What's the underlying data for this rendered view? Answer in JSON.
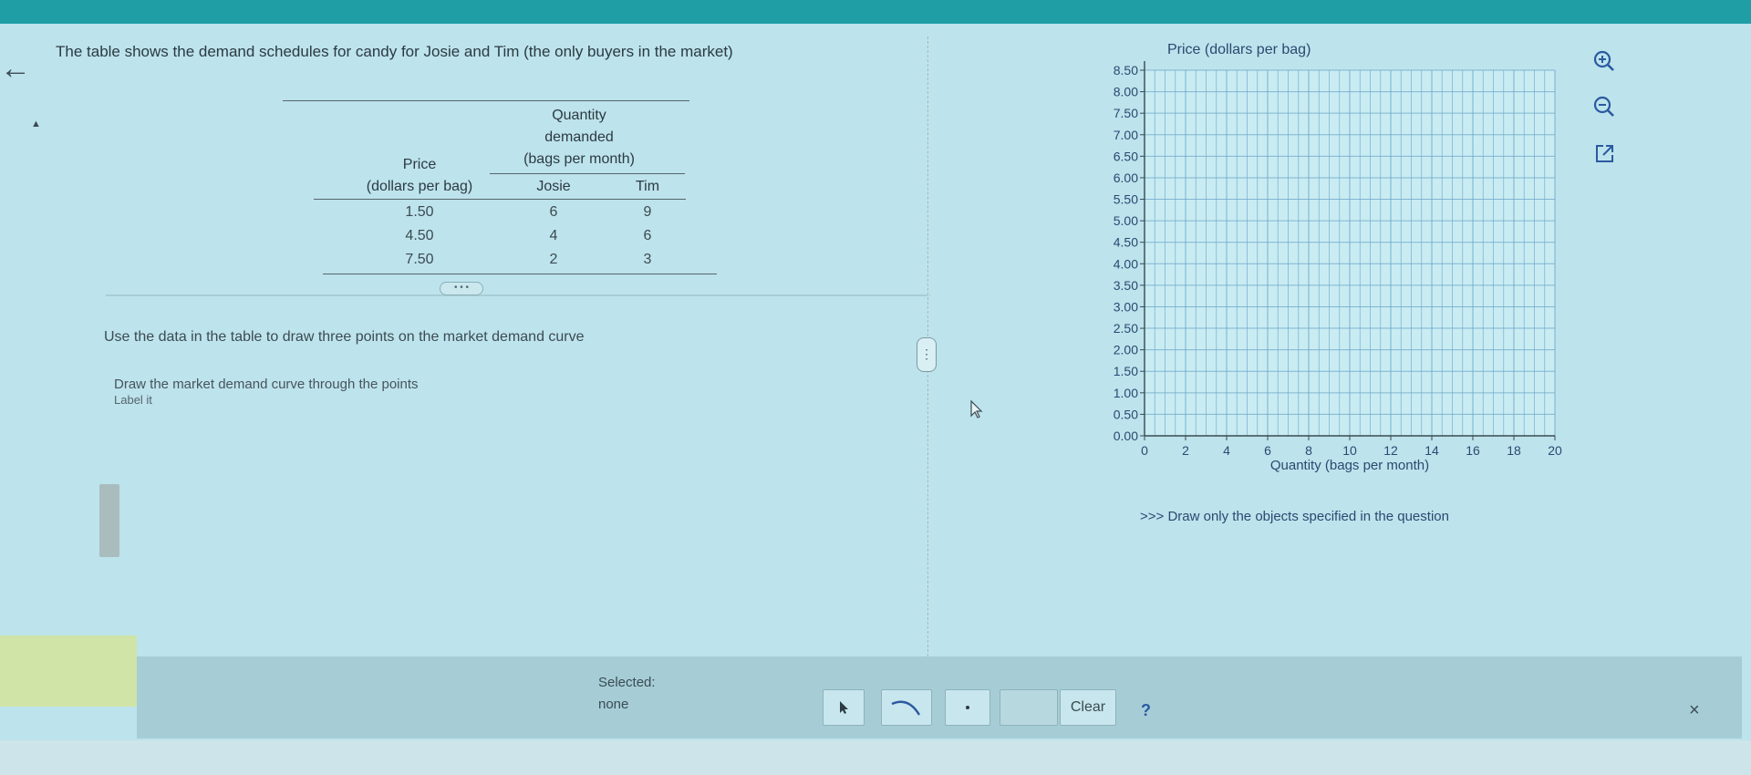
{
  "prompt": "The table shows the demand schedules for candy for Josie and Tim (the only buyers in the market)",
  "table": {
    "header_group": [
      "Quantity",
      "demanded",
      "(bags per month)"
    ],
    "price_header": [
      "Price",
      "(dollars per bag)"
    ],
    "columns": [
      "Josie",
      "Tim"
    ],
    "rows": [
      {
        "price": "1.50",
        "josie": "6",
        "tim": "9"
      },
      {
        "price": "4.50",
        "josie": "4",
        "tim": "6"
      },
      {
        "price": "7.50",
        "josie": "2",
        "tim": "3"
      }
    ]
  },
  "more_button_label": "• • •",
  "instructions": {
    "line1": "Use the data in the table to draw three points on the market demand curve",
    "line2": "Draw the market demand curve through the points",
    "line3": "Label it"
  },
  "split_handle_label": "⋮",
  "graph": {
    "y_axis_title": "Price (dollars per bag)",
    "x_axis_title": "Quantity (bags per month)",
    "y_ticks": [
      "0.00",
      "0.50",
      "1.00",
      "1.50",
      "2.00",
      "2.50",
      "3.00",
      "3.50",
      "4.00",
      "4.50",
      "5.00",
      "5.50",
      "6.00",
      "6.50",
      "7.00",
      "7.50",
      "8.00",
      "8.50"
    ],
    "x_ticks": [
      "0",
      "2",
      "4",
      "6",
      "8",
      "10",
      "12",
      "14",
      "16",
      "18",
      "20"
    ],
    "note": ">>> Draw only the objects specified in the question"
  },
  "toolbar": {
    "selected_label": "Selected:",
    "selected_value": "none",
    "clear_label": "Clear",
    "help_label": "?",
    "close_label": "×"
  },
  "icons": [
    "back-arrow-icon",
    "zoom-in-icon",
    "zoom-out-icon",
    "popout-icon",
    "pointer-tool-icon",
    "curve-tool-icon",
    "point-tool-icon",
    "mouse-cursor-icon",
    "close-icon"
  ],
  "colors": {
    "background": "#bde3ec",
    "topbar": "#1f9ea6",
    "axis_text": "#2a4a70",
    "grid": "#6fa8c8"
  }
}
